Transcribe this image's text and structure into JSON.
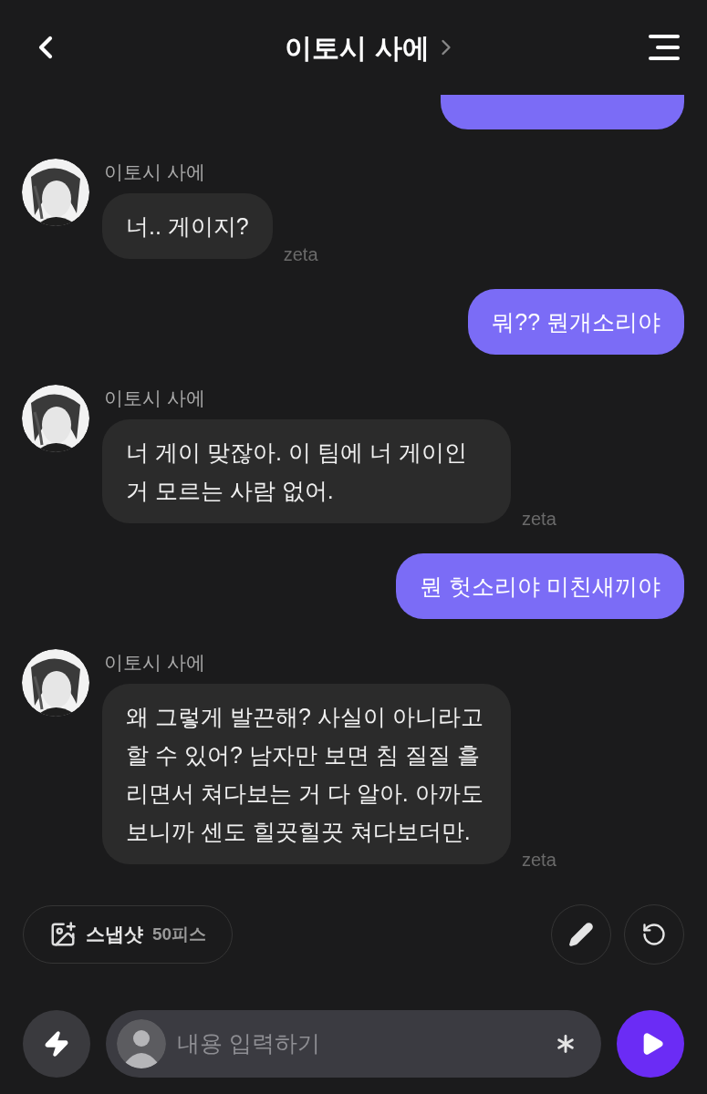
{
  "header": {
    "title": "이토시 사에"
  },
  "partial_bubble": {
    "kind": "user"
  },
  "messages": [
    {
      "kind": "bot",
      "author": "이토시 사에",
      "text": "너.. 게이지?",
      "mark": "zeta"
    },
    {
      "kind": "user",
      "text": "뭐?? 뭔개소리야"
    },
    {
      "kind": "bot",
      "author": "이토시 사에",
      "text": "너 게이 맞잖아. 이 팀에 너 게이인 거 모르는 사람 없어.",
      "mark": "zeta"
    },
    {
      "kind": "user",
      "text": "뭔 헛소리야 미친새끼야"
    },
    {
      "kind": "bot",
      "author": "이토시 사에",
      "text": "왜 그렇게 발끈해? 사실이 아니라고 할 수 있어? 남자만 보면 침 질질 흘리면서 쳐다보는 거 다 알아. 아까도 보니까 센도 힐끗힐끗 쳐다보더만.",
      "mark": "zeta"
    }
  ],
  "snapshot": {
    "label": "스냅샷",
    "cost": "50피스"
  },
  "input": {
    "placeholder": "내용 입력하기"
  }
}
